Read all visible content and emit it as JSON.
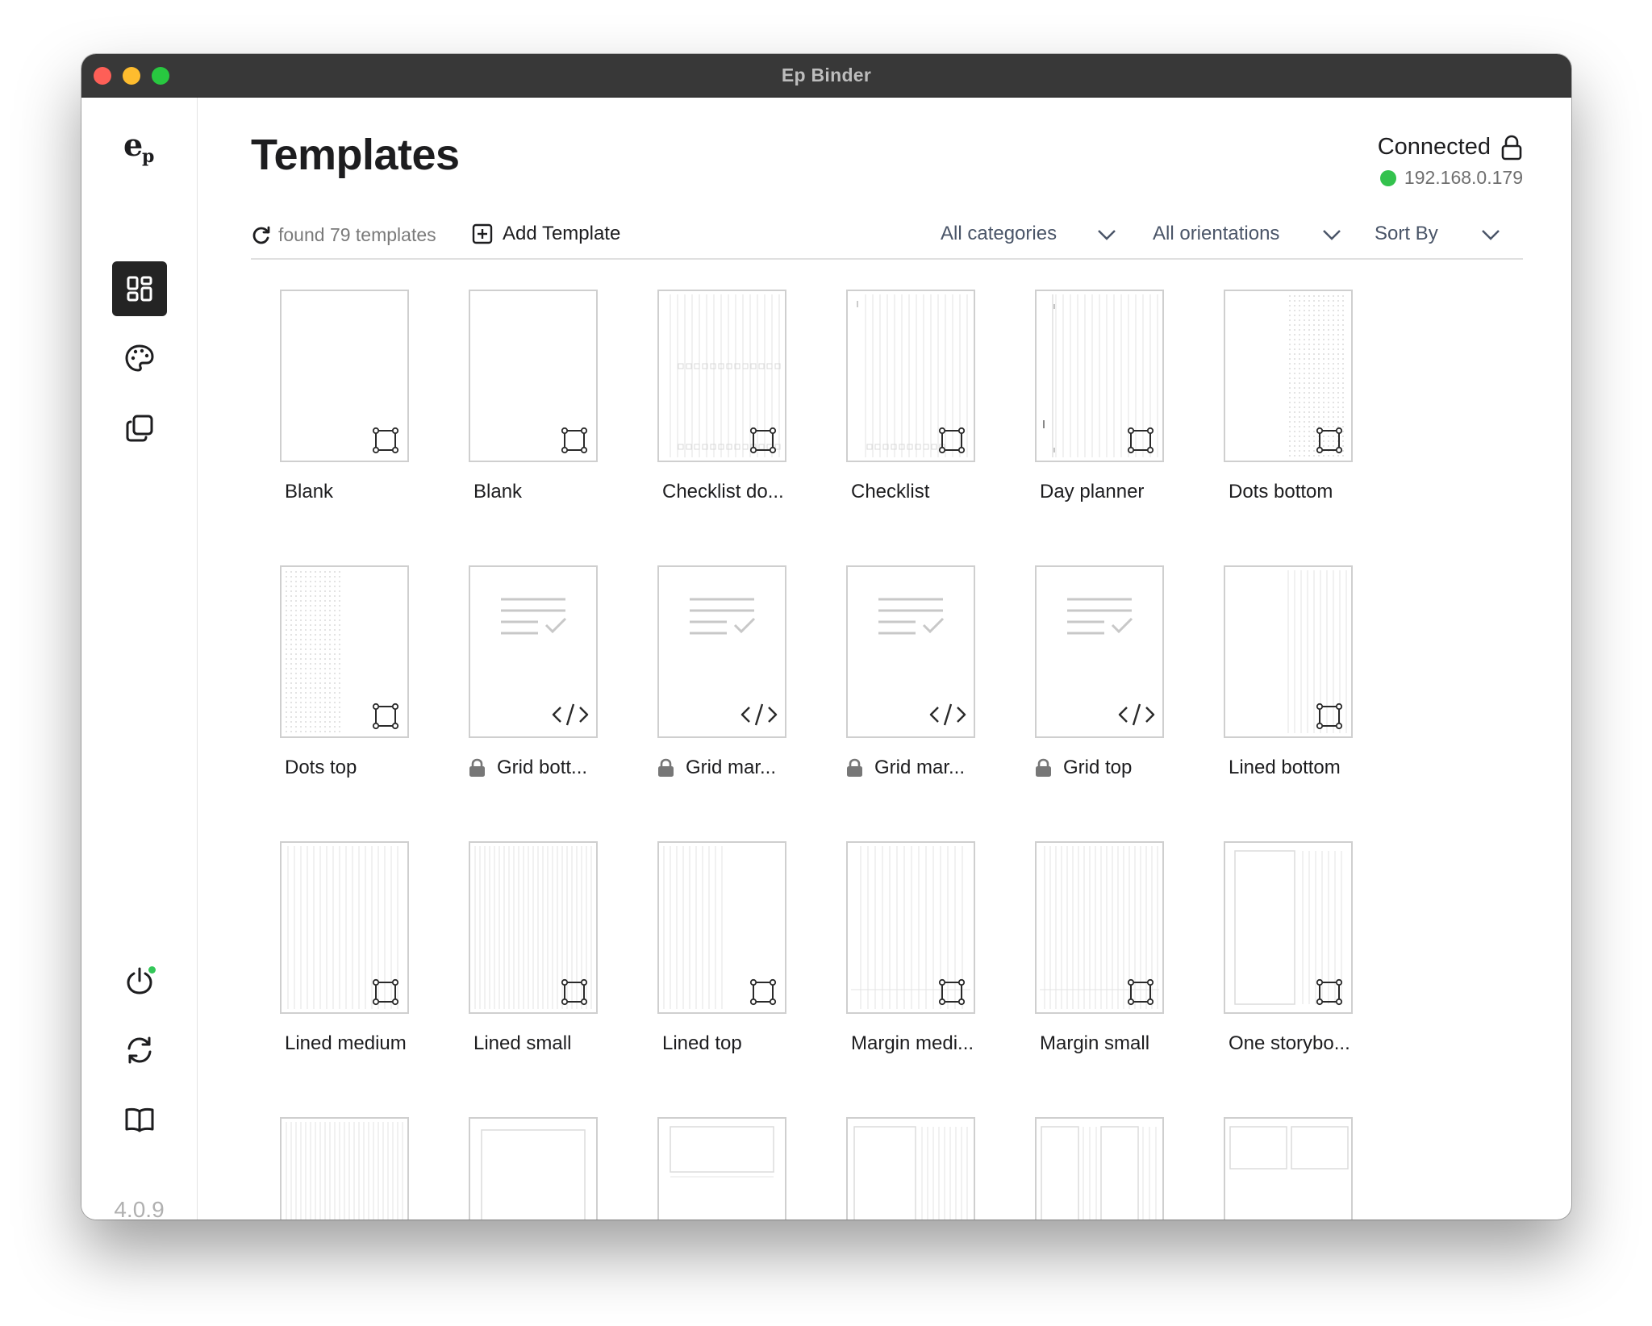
{
  "window": {
    "title": "Ep Binder"
  },
  "sidebar": {
    "logo_icon": "ep-logo-icon",
    "items": [
      {
        "name": "templates",
        "icon": "dashboard-icon",
        "active": true
      },
      {
        "name": "themes",
        "icon": "palette-icon",
        "active": false
      },
      {
        "name": "copies",
        "icon": "copy-icon",
        "active": false
      }
    ],
    "bottom_items": [
      {
        "name": "power",
        "icon": "power-icon"
      },
      {
        "name": "sync",
        "icon": "sync-icon"
      },
      {
        "name": "docs",
        "icon": "book-icon"
      }
    ],
    "version": "4.0.9"
  },
  "header": {
    "title": "Templates",
    "connection": {
      "status": "Connected",
      "ip": "192.168.0.179",
      "status_color": "#33c24d"
    }
  },
  "toolbar": {
    "found_text": "found 79 templates",
    "add_label": "Add Template",
    "categories_value": "All categories",
    "orientations_value": "All orientations",
    "sort_value": "Sort By"
  },
  "templates": [
    {
      "label": "Blank",
      "locked": false,
      "badge": "node-icon",
      "pattern": "blank"
    },
    {
      "label": "Blank",
      "locked": false,
      "badge": "node-icon",
      "pattern": "blank"
    },
    {
      "label": "Checklist do...",
      "locked": false,
      "badge": "node-icon",
      "pattern": "checklist-dots"
    },
    {
      "label": "Checklist",
      "locked": false,
      "badge": "node-icon",
      "pattern": "checklist"
    },
    {
      "label": "Day planner",
      "locked": false,
      "badge": "node-icon",
      "pattern": "dayplanner"
    },
    {
      "label": "Dots bottom",
      "locked": false,
      "badge": "node-icon",
      "pattern": "dots-right"
    },
    {
      "label": "Dots top",
      "locked": false,
      "badge": "node-icon",
      "pattern": "dots-left"
    },
    {
      "label": "Grid bott...",
      "locked": true,
      "badge": "code-icon",
      "pattern": "code"
    },
    {
      "label": "Grid mar...",
      "locked": true,
      "badge": "code-icon",
      "pattern": "code"
    },
    {
      "label": "Grid mar...",
      "locked": true,
      "badge": "code-icon",
      "pattern": "code"
    },
    {
      "label": "Grid top",
      "locked": true,
      "badge": "code-icon",
      "pattern": "code"
    },
    {
      "label": "Lined bottom",
      "locked": false,
      "badge": "node-icon",
      "pattern": "lines-right"
    },
    {
      "label": "Lined medium",
      "locked": false,
      "badge": "node-icon",
      "pattern": "lines-medium"
    },
    {
      "label": "Lined small",
      "locked": false,
      "badge": "node-icon",
      "pattern": "lines-small"
    },
    {
      "label": "Lined top",
      "locked": false,
      "badge": "node-icon",
      "pattern": "lines-left"
    },
    {
      "label": "Margin medi...",
      "locked": false,
      "badge": "node-icon",
      "pattern": "margin-medium"
    },
    {
      "label": "Margin small",
      "locked": false,
      "badge": "node-icon",
      "pattern": "margin-small"
    },
    {
      "label": "One storybo...",
      "locked": false,
      "badge": "node-icon",
      "pattern": "storyboard"
    },
    {
      "label": "",
      "locked": false,
      "badge": "",
      "pattern": "lines-small"
    },
    {
      "label": "",
      "locked": false,
      "badge": "",
      "pattern": "frame"
    },
    {
      "label": "",
      "locked": false,
      "badge": "",
      "pattern": "frame-wide"
    },
    {
      "label": "",
      "locked": false,
      "badge": "",
      "pattern": "frame-lines"
    },
    {
      "label": "",
      "locked": false,
      "badge": "",
      "pattern": "two-col"
    },
    {
      "label": "",
      "locked": false,
      "badge": "",
      "pattern": "two-box"
    }
  ]
}
